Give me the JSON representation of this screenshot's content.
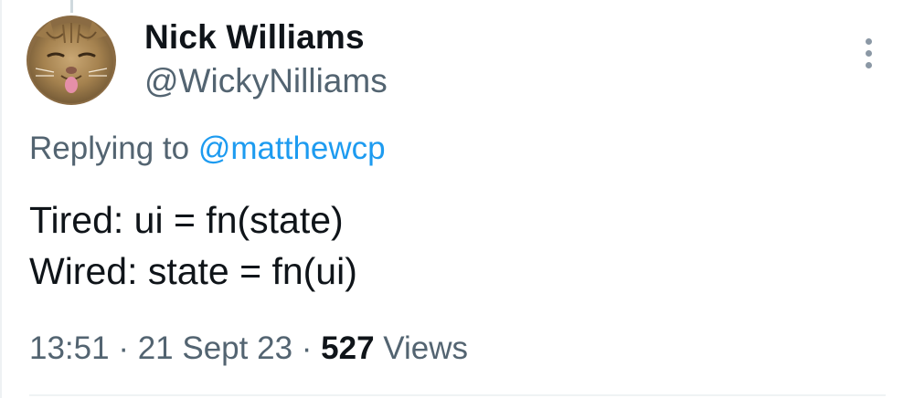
{
  "author": {
    "display_name": "Nick Williams",
    "handle": "@WickyNilliams",
    "avatar": "cat-avatar"
  },
  "reply_context": {
    "prefix": "Replying to",
    "mention": "@matthewcp"
  },
  "tweet": {
    "lines": [
      "Tired: ui = fn(state)",
      "Wired: state = fn(ui)"
    ]
  },
  "meta": {
    "time": "13:51",
    "separator": "·",
    "date": "21 Sept 23",
    "views_count": "527",
    "views_label": "Views"
  },
  "icons": {
    "more": "more-vertical-icon"
  },
  "colors": {
    "text_primary": "#0f1419",
    "text_secondary": "#536471",
    "link": "#1d9bf0",
    "divider": "#eff3f4"
  }
}
